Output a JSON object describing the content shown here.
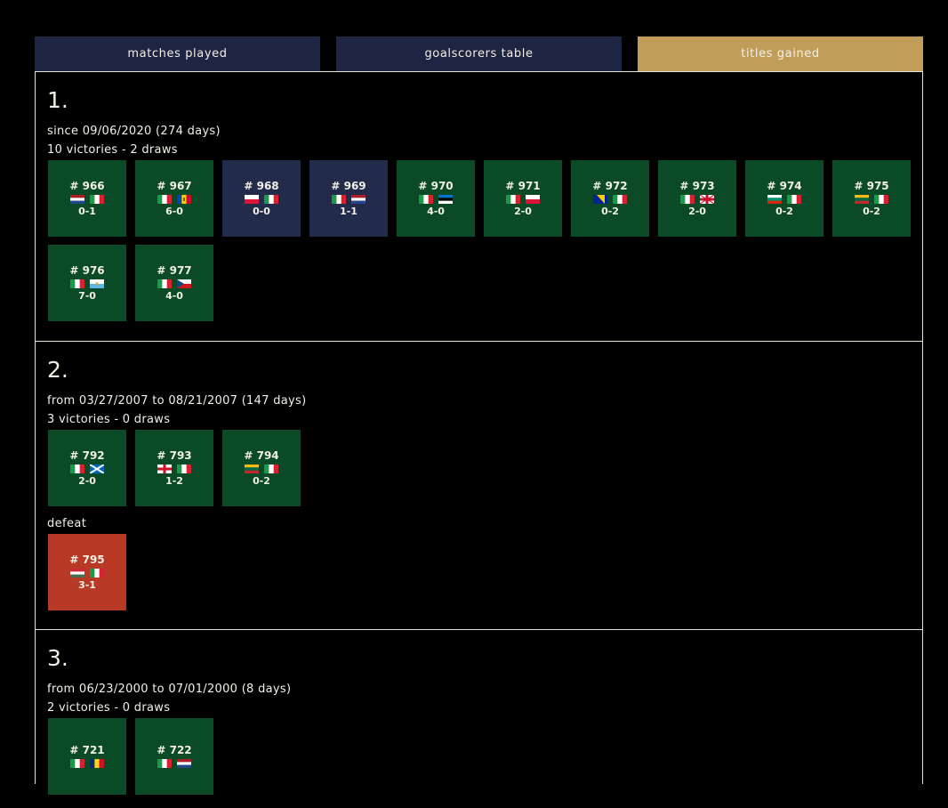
{
  "tabs": [
    {
      "label": "Matches Played"
    },
    {
      "label": "Goalscorers Table"
    },
    {
      "label": "Titles Gained"
    }
  ],
  "colors": {
    "win": "#0b4a27",
    "draw": "#232b4a",
    "defeat": "#b83a26",
    "active_tab": "#c09e59",
    "tab": "#1d2542"
  },
  "streaks": [
    {
      "rank": "1.",
      "period": "since 09/06/2020 (274 days)",
      "summary": "10 victories - 2 draws",
      "matches": [
        {
          "num": "# 966",
          "home": "netherlands",
          "away": "italy",
          "score": "0-1",
          "result": "win"
        },
        {
          "num": "# 967",
          "home": "italy",
          "away": "moldova",
          "score": "6-0",
          "result": "win"
        },
        {
          "num": "# 968",
          "home": "poland",
          "away": "italy",
          "score": "0-0",
          "result": "draw"
        },
        {
          "num": "# 969",
          "home": "italy",
          "away": "netherlands",
          "score": "1-1",
          "result": "draw"
        },
        {
          "num": "# 970",
          "home": "italy",
          "away": "estonia",
          "score": "4-0",
          "result": "win"
        },
        {
          "num": "# 971",
          "home": "italy",
          "away": "poland",
          "score": "2-0",
          "result": "win"
        },
        {
          "num": "# 972",
          "home": "bosnia",
          "away": "italy",
          "score": "0-2",
          "result": "win"
        },
        {
          "num": "# 973",
          "home": "italy",
          "away": "northern-ireland",
          "score": "2-0",
          "result": "win"
        },
        {
          "num": "# 974",
          "home": "bulgaria",
          "away": "italy",
          "score": "0-2",
          "result": "win"
        },
        {
          "num": "# 975",
          "home": "lithuania",
          "away": "italy",
          "score": "0-2",
          "result": "win"
        },
        {
          "num": "# 976",
          "home": "italy",
          "away": "san-marino",
          "score": "7-0",
          "result": "win"
        },
        {
          "num": "# 977",
          "home": "italy",
          "away": "czech-republic",
          "score": "4-0",
          "result": "win"
        }
      ]
    },
    {
      "rank": "2.",
      "period": "from 03/27/2007 to 08/21/2007 (147 days)",
      "summary": "3 victories - 0 draws",
      "matches": [
        {
          "num": "# 792",
          "home": "italy",
          "away": "scotland",
          "score": "2-0",
          "result": "win"
        },
        {
          "num": "# 793",
          "home": "england",
          "away": "italy",
          "score": "1-2",
          "result": "win"
        },
        {
          "num": "# 794",
          "home": "lithuania",
          "away": "italy",
          "score": "0-2",
          "result": "win"
        }
      ],
      "defeat_label": "defeat",
      "defeat": {
        "num": "# 795",
        "home": "hungary",
        "away": "italy",
        "score": "3-1",
        "result": "defeat"
      }
    },
    {
      "rank": "3.",
      "period": "from 06/23/2000 to 07/01/2000 (8 days)",
      "summary": "2 victories - 0 draws",
      "matches": [
        {
          "num": "# 721",
          "home": "italy",
          "away": "romania",
          "score": "",
          "result": "win"
        },
        {
          "num": "# 722",
          "home": "italy",
          "away": "netherlands",
          "score": "",
          "result": "win"
        }
      ]
    }
  ]
}
